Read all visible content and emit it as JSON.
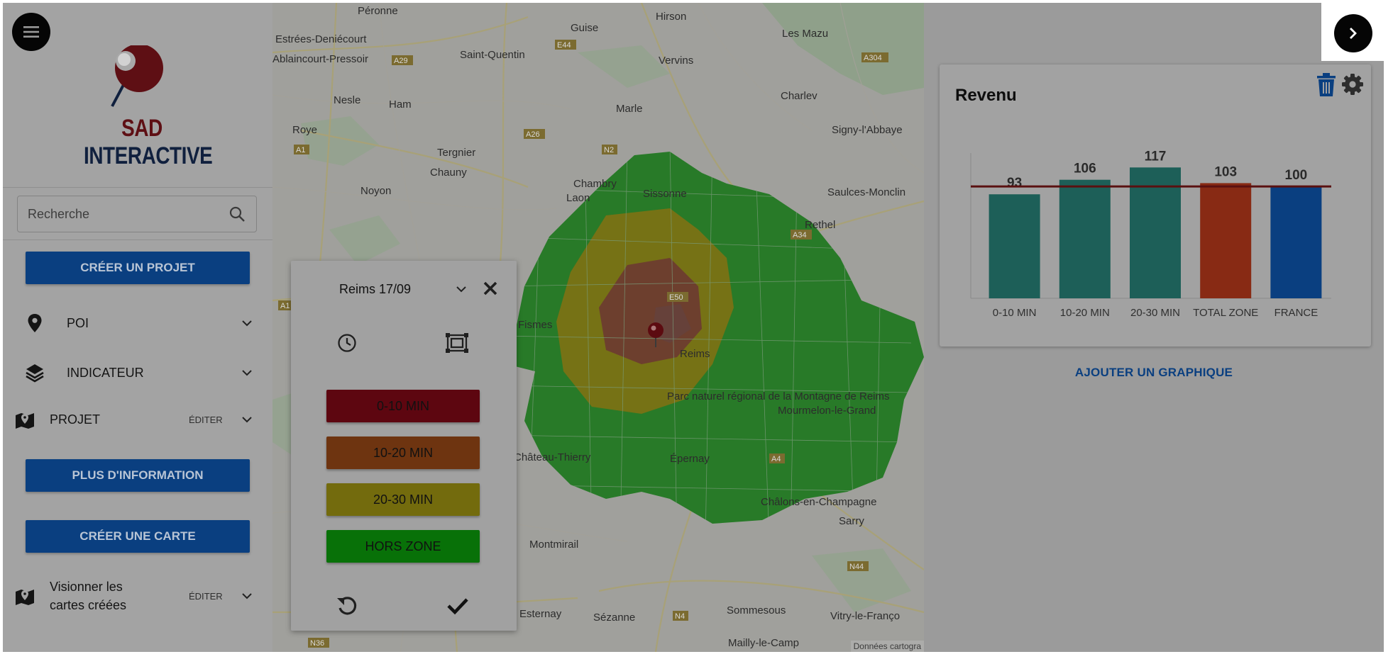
{
  "sidebar": {
    "menu_icon": "hamburger-icon",
    "logo": {
      "word1": "SAD",
      "word2": "INTERACTIVE"
    },
    "search": {
      "placeholder": "Recherche",
      "value": ""
    },
    "buttons": {
      "create_project": "CRÉER UN PROJET",
      "more_info": "PLUS D'INFORMATION",
      "create_map": "CRÉER UNE CARTE"
    },
    "items": [
      {
        "label": "POI",
        "icon": "map-pin-icon"
      },
      {
        "label": "INDICATEUR",
        "icon": "layers-icon"
      },
      {
        "label": "PROJET",
        "icon": "map-marker-icon",
        "edit": "ÉDITER"
      },
      {
        "label_line1": "Visionner les",
        "label_line2": "cartes créées",
        "icon": "map-marker-icon",
        "edit": "ÉDITER"
      }
    ]
  },
  "map": {
    "credit": "Données cartogra",
    "places": [
      "Péronne",
      "Guise",
      "Hirson",
      "Les Mazu",
      "Estrées-Deniécourt",
      "Saint-Quentin",
      "Vervins",
      "Ablaincourt-Pressoir",
      "Nesle",
      "Ham",
      "Marle",
      "Charlev",
      "Roye",
      "Tergnier",
      "Signy-l'Abbaye",
      "Chauny",
      "Noyon",
      "Chambry",
      "Laon",
      "Sissonne",
      "Saulces-Monclin",
      "Rethel",
      "Fismes",
      "Reims",
      "Parc naturel régional de la Montagne de Reims",
      "Mourmelon-le-Grand",
      "Épernay",
      "Châlons-en-Champagne",
      "Sarry",
      "Château-Thierry",
      "Montmirail",
      "Esternay",
      "Sézanne",
      "Sommesous",
      "Vitry-le-Franço",
      "Mailly-le-Camp"
    ],
    "roads": [
      "E44",
      "A29",
      "A304",
      "A26",
      "N2",
      "A1",
      "A34",
      "A4",
      "E50",
      "N44",
      "N4",
      "N36",
      "A26",
      "A1"
    ]
  },
  "popup": {
    "title": "Reims 17/09",
    "zones": [
      {
        "label": "0-10 MIN",
        "color": "#5d0610"
      },
      {
        "label": "10-20 MIN",
        "color": "#6e3410"
      },
      {
        "label": "20-30 MIN",
        "color": "#736b0d"
      },
      {
        "label": "HORS ZONE",
        "color": "#087108"
      }
    ]
  },
  "right_panel": {
    "card": {
      "title": "Revenu",
      "chart_data": {
        "type": "bar",
        "categories": [
          "0-10 MIN",
          "10-20 MIN",
          "20-30 MIN",
          "TOTAL ZONE",
          "FRANCE"
        ],
        "values": [
          93,
          106,
          117,
          103,
          100
        ],
        "colors": [
          "#1d5f58",
          "#1d5f58",
          "#1d5f58",
          "#882a14",
          "#0a3f80"
        ],
        "reference_line": 100,
        "reference_color": "#5a1010",
        "ylim": [
          0,
          130
        ]
      }
    },
    "add_chart": "AJOUTER UN GRAPHIQUE"
  }
}
